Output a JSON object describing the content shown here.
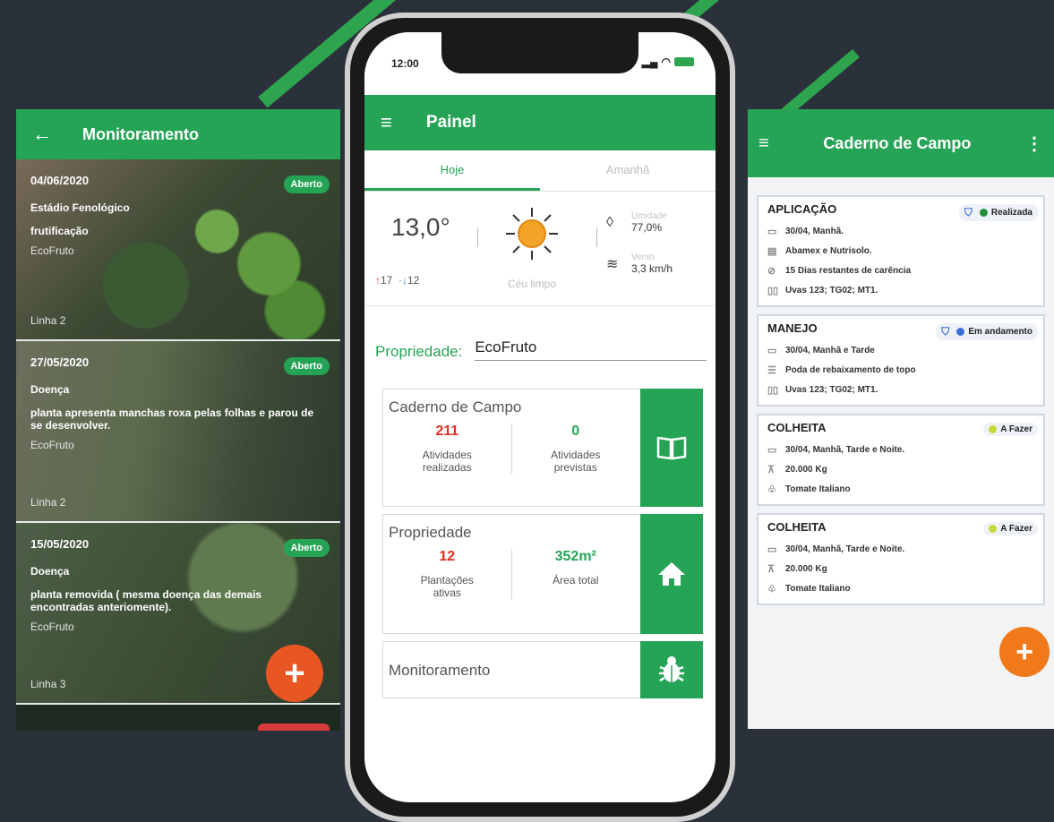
{
  "colors": {
    "primary_green": "#25a456",
    "background": "#2b313b",
    "red": "#e0301e",
    "orange": "#e85624"
  },
  "monitoramento": {
    "title": "Monitoramento",
    "back_icon": "arrow-left-icon",
    "cards": [
      {
        "date": "04/06/2020",
        "badge": "Aberto",
        "type": "Estádio Fenológico",
        "desc": "frutificação",
        "farm": "EcoFruto",
        "line": "Linha 2"
      },
      {
        "date": "27/05/2020",
        "badge": "Aberto",
        "type": "Doença",
        "desc": "planta apresenta manchas roxa pelas folhas e parou de se desenvolver.",
        "farm": "EcoFruto",
        "line": "Linha 2"
      },
      {
        "date": "15/05/2020",
        "badge": "Aberto",
        "type": "Doença",
        "desc": "planta removida ( mesma doença das demais encontradas anteriomente).",
        "farm": "EcoFruto",
        "line": "Linha 3"
      }
    ],
    "fab": "+"
  },
  "painel": {
    "status_time": "12:00",
    "title": "Painel",
    "tabs": [
      "Hoje",
      "Amanhã"
    ],
    "weather": {
      "temp": "13,0°",
      "max": "17",
      "min": "12",
      "sky": "Céu limpo",
      "humidity_label": "Umidade",
      "humidity": "77,0%",
      "wind_label": "Vento",
      "wind": "3,3 km/h"
    },
    "property_label": "Propriedade:",
    "property_value": "EcoFruto",
    "caderno": {
      "title": "Caderno de Campo",
      "done_num": "211",
      "done_label_1": "Atividades",
      "done_label_2": "realizadas",
      "plan_num": "0",
      "plan_label_1": "Atividades",
      "plan_label_2": "previstas",
      "icon": "book-icon"
    },
    "propriedade": {
      "title": "Propriedade",
      "plant_num": "12",
      "plant_label_1": "Plantações",
      "plant_label_2": "ativas",
      "area_num": "352m²",
      "area_label": "Área total",
      "icon": "home-icon"
    },
    "monitoramento": {
      "title": "Monitoramento",
      "icon": "bug-icon"
    }
  },
  "caderno_campo": {
    "title": "Caderno de Campo",
    "cards": [
      {
        "title": "APLICAÇÃO",
        "status": "Realizada",
        "status_color": "#1f8f3a",
        "rows": [
          {
            "icon": "calendar-icon",
            "text": "30/04, Manhã."
          },
          {
            "icon": "document-icon",
            "text": "Abamex e Nutrisolo."
          },
          {
            "icon": "block-icon",
            "text": "15 Dias restantes de carência"
          },
          {
            "icon": "map-icon",
            "text": "Uvas 123; TG02; MT1."
          }
        ]
      },
      {
        "title": "MANEJO",
        "status": "Em andamento",
        "status_color": "#3b6fd8",
        "rows": [
          {
            "icon": "calendar-icon",
            "text": "30/04, Manhã e Tarde"
          },
          {
            "icon": "list-icon",
            "text": "Poda de rebaixamento de topo"
          },
          {
            "icon": "map-icon",
            "text": "Uvas 123; TG02; MT1."
          }
        ]
      },
      {
        "title": "COLHEITA",
        "status": "A Fazer",
        "status_color": "#c7d93a",
        "rows": [
          {
            "icon": "calendar-icon",
            "text": "30/04, Manhã, Tarde e Noite."
          },
          {
            "icon": "weight-icon",
            "text": "20.000 Kg"
          },
          {
            "icon": "plant-icon",
            "text": "Tomate Italiano"
          }
        ]
      },
      {
        "title": "COLHEITA",
        "status": "A Fazer",
        "status_color": "#c7d93a",
        "rows": [
          {
            "icon": "calendar-icon",
            "text": "30/04, Manhã, Tarde e Noite."
          },
          {
            "icon": "weight-icon",
            "text": "20.000 Kg"
          },
          {
            "icon": "plant-icon",
            "text": "Tomate Italiano"
          }
        ]
      }
    ],
    "fab": "+"
  }
}
